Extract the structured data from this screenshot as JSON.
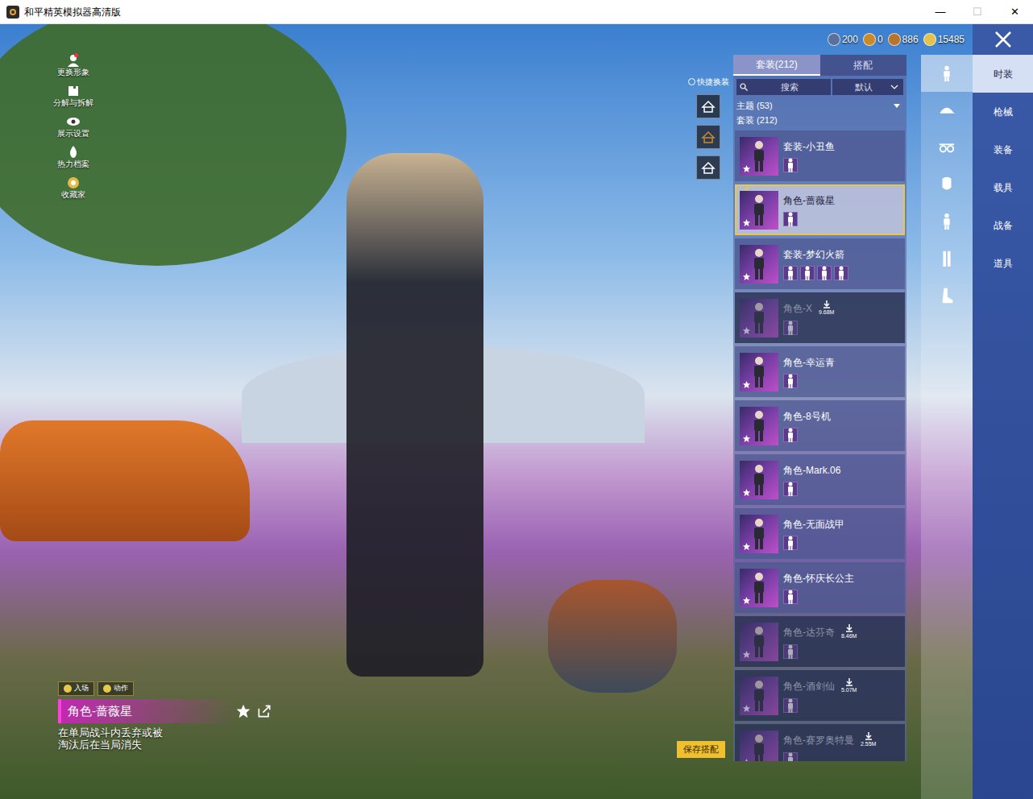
{
  "window": {
    "title": "和平精英模拟器高清版",
    "controls": [
      "—",
      "☐",
      "✕"
    ]
  },
  "side_menu": [
    {
      "label": "更换形象",
      "badge": true
    },
    {
      "label": "分解与拆解",
      "badge": false
    },
    {
      "label": "展示设置",
      "badge": false
    },
    {
      "label": "热力档案",
      "badge": false
    },
    {
      "label": "收藏家",
      "badge": false
    }
  ],
  "currencies": [
    {
      "value": "200",
      "color": "#5a6f9a"
    },
    {
      "value": "0",
      "color": "#c98a2a"
    },
    {
      "value": "886",
      "color": "#b8742a"
    },
    {
      "value": "15485",
      "color": "#e2c24a"
    }
  ],
  "quick_change": {
    "label": "快捷换装"
  },
  "panel": {
    "tabs": [
      {
        "label": "套装(212)",
        "selected": true
      },
      {
        "label": "搭配",
        "selected": false
      }
    ],
    "search": {
      "placeholder": "搜索"
    },
    "sort": {
      "value": "默认"
    },
    "groups": [
      {
        "label": "主题 (53)",
        "expanded": false
      },
      {
        "label": "套装 (212)"
      }
    ],
    "items": [
      {
        "name": "套装-小丑鱼",
        "selected": false,
        "downloaded": true,
        "size": "",
        "parts": 1
      },
      {
        "name": "角色-蔷薇星",
        "selected": true,
        "downloaded": true,
        "size": "",
        "parts": 1
      },
      {
        "name": "套装-梦幻火箭",
        "selected": false,
        "downloaded": true,
        "size": "",
        "parts": 4
      },
      {
        "name": "角色-X",
        "selected": false,
        "downloaded": false,
        "size": "9.68M",
        "parts": 1
      },
      {
        "name": "角色-幸运青",
        "selected": false,
        "downloaded": true,
        "size": "",
        "parts": 1
      },
      {
        "name": "角色-8号机",
        "selected": false,
        "downloaded": true,
        "size": "",
        "parts": 1
      },
      {
        "name": "角色-Mark.06",
        "selected": false,
        "downloaded": true,
        "size": "",
        "parts": 1
      },
      {
        "name": "角色-无面战甲",
        "selected": false,
        "downloaded": true,
        "size": "",
        "parts": 1
      },
      {
        "name": "角色-怀庆长公主",
        "selected": false,
        "downloaded": true,
        "size": "",
        "parts": 1
      },
      {
        "name": "角色-达芬奇",
        "selected": false,
        "downloaded": false,
        "size": "8.46M",
        "parts": 1
      },
      {
        "name": "角色-酒剑仙",
        "selected": false,
        "downloaded": false,
        "size": "5.07M",
        "parts": 1
      },
      {
        "name": "角色-赛罗奥特曼",
        "selected": false,
        "downloaded": false,
        "size": "2.55M",
        "parts": 1
      }
    ]
  },
  "nav_icons": [
    {
      "selected": true
    },
    {
      "selected": false
    },
    {
      "selected": false
    },
    {
      "selected": false
    },
    {
      "selected": false
    },
    {
      "selected": false
    },
    {
      "selected": false
    }
  ],
  "nav": [
    {
      "label": "时装",
      "selected": true
    },
    {
      "label": "枪械",
      "selected": false
    },
    {
      "label": "装备",
      "selected": false
    },
    {
      "label": "载具",
      "selected": false
    },
    {
      "label": "战备",
      "selected": false
    },
    {
      "label": "道具",
      "selected": false
    }
  ],
  "info": {
    "tabs": [
      "入场",
      "动作"
    ],
    "name": "角色-蔷薇星",
    "description": "在单局战斗内丢弃或被淘汰后在当局消失"
  },
  "save_button": {
    "label": "保存搭配"
  }
}
